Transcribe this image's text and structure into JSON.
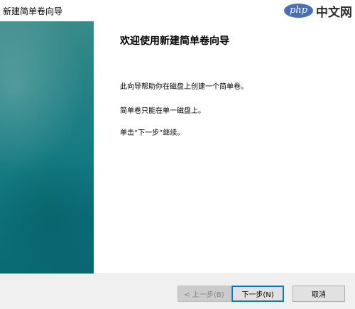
{
  "window": {
    "title": "新建简单卷向导"
  },
  "watermark": {
    "badge": "php",
    "text": "中文网"
  },
  "content": {
    "heading": "欢迎使用新建简单卷向导",
    "paragraphs": [
      "此向导帮助你在磁盘上创建一个简单卷。",
      "简单卷只能在单一磁盘上。",
      "单击“下一步”继续。"
    ]
  },
  "buttons": {
    "back_label": "< 上一步(B)",
    "next_label": "下一步(N)",
    "cancel_label": "取消"
  },
  "colors": {
    "banner_top": "#3f8e8c",
    "banner_bottom": "#0a6670",
    "default_button_border": "#0078d7"
  }
}
